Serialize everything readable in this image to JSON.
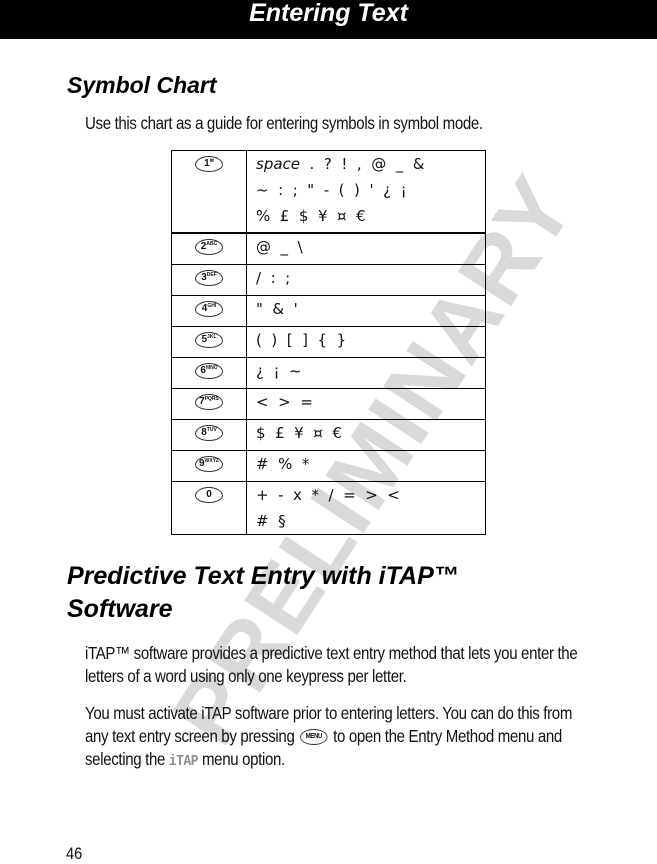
{
  "header": {
    "title": "Entering Text"
  },
  "watermark": "PRELIMINARY",
  "sections": {
    "symbol_chart": {
      "heading": "Symbol Chart",
      "intro": "Use this chart as a guide for entering symbols in symbol mode."
    },
    "itap": {
      "heading": "Predictive Text Entry with iTAP™ Software",
      "para1": "iTAP™ software provides a predictive text entry method that lets you enter the letters of a word using only one keypress per letter.",
      "para2_a": "You must activate iTAP software prior to entering letters. You can do this from any text entry screen by pressing",
      "menu_key_label": "MENU",
      "para2_b": "to open the Entry Method menu and selecting the",
      "option": "iTAP",
      "para2_c": "menu option."
    }
  },
  "symbol_table": {
    "rows": [
      {
        "key": "1",
        "key_sub": "✉",
        "lines": [
          "space  .  ?  !  ,  @  _  &",
          "~  :  ;  \"  -  (  )  '  ¿  ¡",
          "%  £  $  ¥  ¤  €"
        ]
      },
      {
        "key": "2",
        "key_sub": "ABC",
        "lines": [
          "@  _  \\"
        ]
      },
      {
        "key": "3",
        "key_sub": "DEF",
        "lines": [
          "/  :  ;"
        ]
      },
      {
        "key": "4",
        "key_sub": "GHI",
        "lines": [
          "\"  &  '"
        ]
      },
      {
        "key": "5",
        "key_sub": "JKL",
        "lines": [
          "(  )  [  ]  {  }"
        ]
      },
      {
        "key": "6",
        "key_sub": "MNO",
        "lines": [
          "¿  ¡  ~"
        ]
      },
      {
        "key": "7",
        "key_sub": "PQRS",
        "lines": [
          "<  >  ="
        ]
      },
      {
        "key": "8",
        "key_sub": "TUV",
        "lines": [
          "$  £  ¥  ¤  €"
        ]
      },
      {
        "key": "9",
        "key_sub": "WXYZ",
        "lines": [
          "#  %  *"
        ]
      },
      {
        "key": "0",
        "key_sub": "",
        "lines": [
          "+  -  x  *  /  =  >  <",
          "#  §"
        ]
      }
    ]
  },
  "page_number": "46"
}
